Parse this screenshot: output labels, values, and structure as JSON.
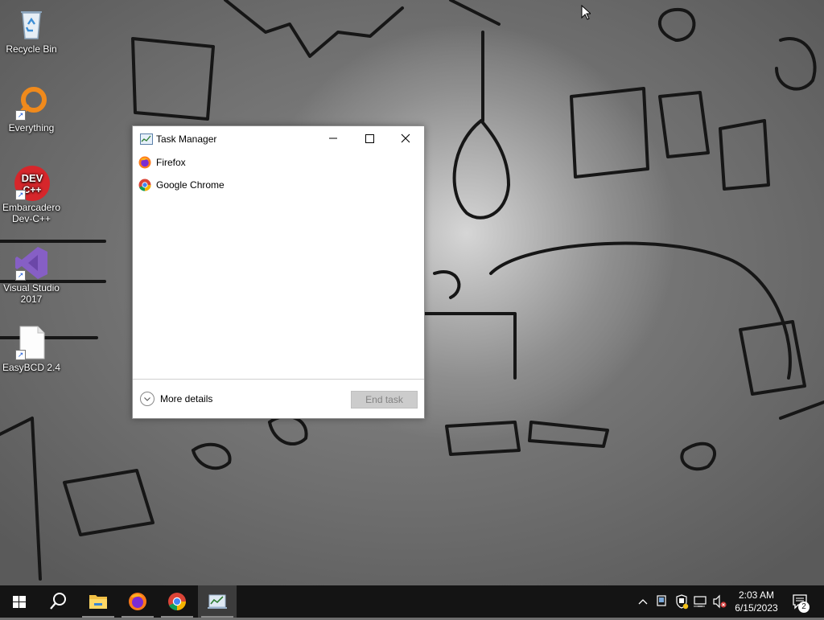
{
  "desktop": {
    "icons": [
      {
        "label": "Recycle Bin",
        "icon": "recycle-bin-icon"
      },
      {
        "label": "Everything",
        "icon": "everything-search-icon"
      },
      {
        "label": "Embarcadero Dev-C++",
        "icon": "devcpp-icon",
        "badge": "DEV C++"
      },
      {
        "label": "Visual Studio 2017",
        "icon": "visual-studio-icon"
      },
      {
        "label": "EasyBCD 2.4",
        "icon": "document-icon"
      }
    ]
  },
  "task_manager": {
    "title": "Task Manager",
    "apps": [
      {
        "name": "Firefox",
        "icon": "firefox-icon"
      },
      {
        "name": "Google Chrome",
        "icon": "chrome-icon"
      }
    ],
    "more_details": "More details",
    "end_task": "End task"
  },
  "taskbar": {
    "pinned": [
      "start-icon",
      "search-icon",
      "file-explorer-icon",
      "firefox-icon",
      "chrome-icon",
      "task-manager-icon"
    ],
    "clock": {
      "time": "2:03 AM",
      "date": "6/15/2023"
    },
    "notification_count": "2"
  }
}
